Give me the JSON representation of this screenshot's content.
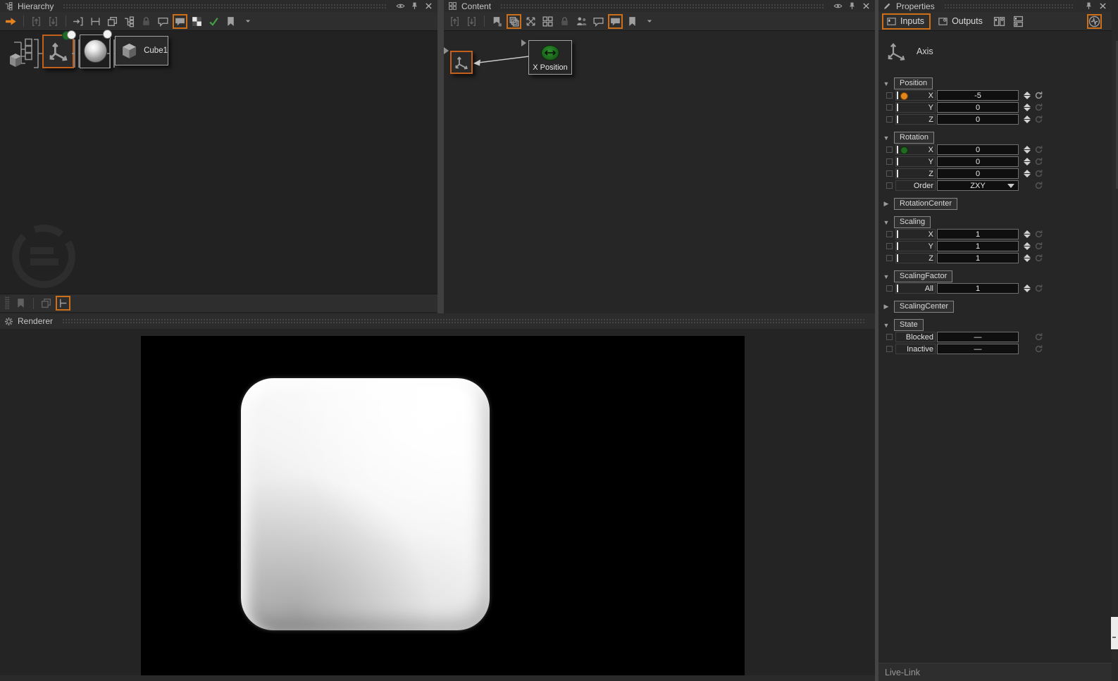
{
  "window": {
    "live_link_label": "Live-Link"
  },
  "colors": {
    "accent": "#cd6f16",
    "orange_dot": "#e2861c",
    "green_dot": "#1f6b1f",
    "icon_gray": "#9f9f9f",
    "wire": "#c8c8c8"
  },
  "hierarchy": {
    "title": "Hierarchy",
    "toolbar": [
      {
        "icon": "arrow-right",
        "name": "follow-selection",
        "accent": "orange"
      },
      {
        "sep": true
      },
      {
        "icon": "bracket-up",
        "name": "move-up",
        "disabled": true
      },
      {
        "icon": "bracket-down",
        "name": "move-down",
        "disabled": true
      },
      {
        "sep": true
      },
      {
        "icon": "arrow-into-bracket",
        "name": "enter-container"
      },
      {
        "icon": "h-bracket",
        "name": "container-bounds"
      },
      {
        "icon": "copy",
        "name": "show-instances"
      },
      {
        "icon": "tree",
        "name": "show-subtree"
      },
      {
        "icon": "lock",
        "name": "lock",
        "disabled": true
      },
      {
        "icon": "bubble",
        "name": "add-comment"
      },
      {
        "icon": "bubble-filled",
        "name": "show-comments",
        "active": true
      },
      {
        "icon": "checkerboard",
        "name": "transparency"
      },
      {
        "icon": "check",
        "name": "validate",
        "accent": "green"
      },
      {
        "icon": "bookmark",
        "name": "bookmarks"
      },
      {
        "icon": "caret-down",
        "name": "bookmarks-menu"
      }
    ],
    "bottom_toolbar": [
      {
        "icon": "bookmark",
        "name": "bookmark-view",
        "disabled": true
      },
      {
        "sep": true
      },
      {
        "icon": "copy",
        "name": "layer-view",
        "disabled": true
      },
      {
        "icon": "tbar",
        "name": "tree-view",
        "active": true
      }
    ],
    "nodes": {
      "cube_label": "Cube1"
    }
  },
  "content": {
    "title": "Content",
    "toolbar": [
      {
        "icon": "bracket-up",
        "name": "move-up",
        "disabled": true
      },
      {
        "icon": "bracket-down",
        "name": "move-down",
        "disabled": true
      },
      {
        "sep": true
      },
      {
        "icon": "flag-pin",
        "name": "pin-node"
      },
      {
        "icon": "layers",
        "name": "show-layers",
        "active": true
      },
      {
        "icon": "x-arrows",
        "name": "collapse-links"
      },
      {
        "icon": "grid4",
        "name": "arrange-grid"
      },
      {
        "icon": "lock",
        "name": "lock",
        "disabled": true
      },
      {
        "icon": "people",
        "name": "shared-nodes"
      },
      {
        "icon": "bubble",
        "name": "add-comment"
      },
      {
        "icon": "bubble-filled",
        "name": "show-comments",
        "active": true
      },
      {
        "icon": "bookmark",
        "name": "bookmarks"
      },
      {
        "icon": "caret-down",
        "name": "bookmarks-menu"
      }
    ],
    "nodes": {
      "x_position_label": "X Position"
    }
  },
  "properties": {
    "title": "Properties",
    "tabs": [
      {
        "label": "Inputs",
        "icon": "io-input",
        "active": true
      },
      {
        "label": "Outputs",
        "icon": "io-output",
        "active": false
      }
    ],
    "view_buttons": [
      {
        "icon": "panels-lr",
        "name": "split-view"
      },
      {
        "icon": "panels-tb",
        "name": "stacked-view"
      }
    ],
    "animation_button": {
      "icon": "waveform",
      "name": "animation-editor",
      "active": true
    },
    "node_type": "Axis",
    "sections": [
      {
        "label": "Position",
        "expanded": true,
        "rows": [
          {
            "label": "X",
            "value": "-5",
            "dot": "orange",
            "bar": true,
            "spinner": true,
            "reset": "bright"
          },
          {
            "label": "Y",
            "value": "0",
            "bar": true,
            "spinner": true,
            "reset": "dim"
          },
          {
            "label": "Z",
            "value": "0",
            "bar": true,
            "spinner": true,
            "reset": "dim"
          }
        ]
      },
      {
        "label": "Rotation",
        "expanded": true,
        "rows": [
          {
            "label": "X",
            "value": "0",
            "dot": "green",
            "bar": true,
            "spinner": true,
            "reset": "dim"
          },
          {
            "label": "Y",
            "value": "0",
            "bar": true,
            "spinner": true,
            "reset": "dim"
          },
          {
            "label": "Z",
            "value": "0",
            "bar": true,
            "spinner": true,
            "reset": "dim"
          },
          {
            "label": "Order",
            "value": "ZXY",
            "type": "dropdown",
            "reset": "dim"
          }
        ]
      },
      {
        "label": "RotationCenter",
        "expanded": false,
        "rows": []
      },
      {
        "label": "Scaling",
        "expanded": true,
        "rows": [
          {
            "label": "X",
            "value": "1",
            "bar": true,
            "spinner": true,
            "reset": "dim"
          },
          {
            "label": "Y",
            "value": "1",
            "bar": true,
            "spinner": true,
            "reset": "dim"
          },
          {
            "label": "Z",
            "value": "1",
            "bar": true,
            "spinner": true,
            "reset": "dim"
          }
        ]
      },
      {
        "label": "ScalingFactor",
        "expanded": true,
        "rows": [
          {
            "label": "All",
            "value": "1",
            "bar": true,
            "spinner": true,
            "reset": "dim"
          }
        ]
      },
      {
        "label": "ScalingCenter",
        "expanded": false,
        "rows": []
      },
      {
        "label": "State",
        "expanded": true,
        "rows": [
          {
            "label": "Blocked",
            "value": "—",
            "type": "dash",
            "reset": "dim"
          },
          {
            "label": "Inactive",
            "value": "—",
            "type": "dash",
            "reset": "dim"
          }
        ]
      }
    ]
  },
  "renderer": {
    "title": "Renderer"
  }
}
